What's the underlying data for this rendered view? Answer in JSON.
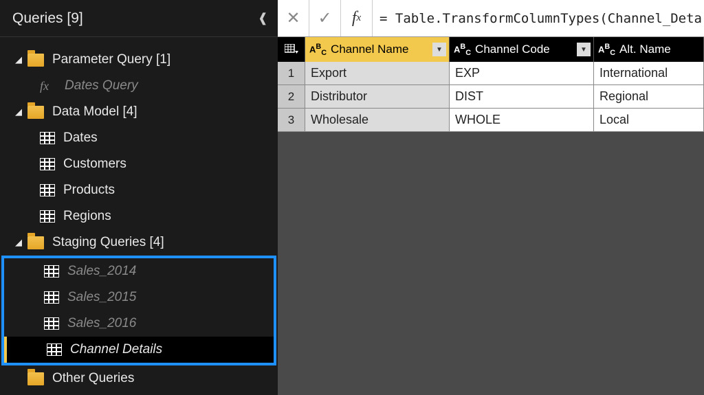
{
  "sidebar": {
    "title": "Queries [9]",
    "groups": [
      {
        "label": "Parameter Query [1]",
        "items": [
          {
            "label": "Dates Query",
            "kind": "fx",
            "disabled": true
          }
        ]
      },
      {
        "label": "Data Model [4]",
        "items": [
          {
            "label": "Dates",
            "kind": "table"
          },
          {
            "label": "Customers",
            "kind": "table"
          },
          {
            "label": "Products",
            "kind": "table"
          },
          {
            "label": "Regions",
            "kind": "table"
          }
        ]
      },
      {
        "label": "Staging Queries [4]",
        "highlight": true,
        "items": [
          {
            "label": "Sales_2014",
            "kind": "table",
            "disabled": true
          },
          {
            "label": "Sales_2015",
            "kind": "table",
            "disabled": true
          },
          {
            "label": "Sales_2016",
            "kind": "table",
            "disabled": true
          },
          {
            "label": "Channel Details",
            "kind": "table",
            "italic": true,
            "selected": true
          }
        ]
      },
      {
        "label": "Other Queries",
        "items": []
      }
    ]
  },
  "formula": "= Table.TransformColumnTypes(Channel_Deta",
  "table": {
    "columns": [
      {
        "name": "Channel Name",
        "type": "ABC",
        "selected": true
      },
      {
        "name": "Channel Code",
        "type": "ABC"
      },
      {
        "name": "Alt. Name",
        "type": "ABC"
      }
    ],
    "rows": [
      [
        "Export",
        "EXP",
        "International"
      ],
      [
        "Distributor",
        "DIST",
        "Regional"
      ],
      [
        "Wholesale",
        "WHOLE",
        "Local"
      ]
    ]
  }
}
